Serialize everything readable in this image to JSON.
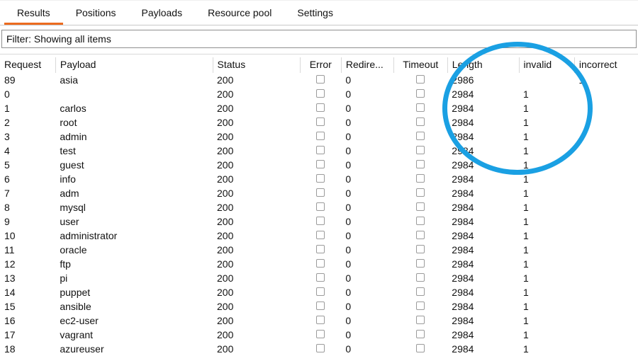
{
  "tabs": [
    "Results",
    "Positions",
    "Payloads",
    "Resource pool",
    "Settings"
  ],
  "active_tab": 0,
  "filter_text": "Filter: Showing all items",
  "columns": [
    "Request",
    "Payload",
    "Status",
    "Error",
    "Redire...",
    "Timeout",
    "Length",
    "invalid",
    "incorrect"
  ],
  "rows": [
    {
      "req": "89",
      "pay": "asia",
      "sta": "200",
      "red": "0",
      "len": "2986",
      "inv": "",
      "inc": "1"
    },
    {
      "req": "0",
      "pay": "",
      "sta": "200",
      "red": "0",
      "len": "2984",
      "inv": "1",
      "inc": ""
    },
    {
      "req": "1",
      "pay": "carlos",
      "sta": "200",
      "red": "0",
      "len": "2984",
      "inv": "1",
      "inc": ""
    },
    {
      "req": "2",
      "pay": "root",
      "sta": "200",
      "red": "0",
      "len": "2984",
      "inv": "1",
      "inc": ""
    },
    {
      "req": "3",
      "pay": "admin",
      "sta": "200",
      "red": "0",
      "len": "2984",
      "inv": "1",
      "inc": ""
    },
    {
      "req": "4",
      "pay": "test",
      "sta": "200",
      "red": "0",
      "len": "2984",
      "inv": "1",
      "inc": ""
    },
    {
      "req": "5",
      "pay": "guest",
      "sta": "200",
      "red": "0",
      "len": "2984",
      "inv": "1",
      "inc": ""
    },
    {
      "req": "6",
      "pay": "info",
      "sta": "200",
      "red": "0",
      "len": "2984",
      "inv": "1",
      "inc": ""
    },
    {
      "req": "7",
      "pay": "adm",
      "sta": "200",
      "red": "0",
      "len": "2984",
      "inv": "1",
      "inc": ""
    },
    {
      "req": "8",
      "pay": "mysql",
      "sta": "200",
      "red": "0",
      "len": "2984",
      "inv": "1",
      "inc": ""
    },
    {
      "req": "9",
      "pay": "user",
      "sta": "200",
      "red": "0",
      "len": "2984",
      "inv": "1",
      "inc": ""
    },
    {
      "req": "10",
      "pay": "administrator",
      "sta": "200",
      "red": "0",
      "len": "2984",
      "inv": "1",
      "inc": ""
    },
    {
      "req": "11",
      "pay": "oracle",
      "sta": "200",
      "red": "0",
      "len": "2984",
      "inv": "1",
      "inc": ""
    },
    {
      "req": "12",
      "pay": "ftp",
      "sta": "200",
      "red": "0",
      "len": "2984",
      "inv": "1",
      "inc": ""
    },
    {
      "req": "13",
      "pay": "pi",
      "sta": "200",
      "red": "0",
      "len": "2984",
      "inv": "1",
      "inc": ""
    },
    {
      "req": "14",
      "pay": "puppet",
      "sta": "200",
      "red": "0",
      "len": "2984",
      "inv": "1",
      "inc": ""
    },
    {
      "req": "15",
      "pay": "ansible",
      "sta": "200",
      "red": "0",
      "len": "2984",
      "inv": "1",
      "inc": ""
    },
    {
      "req": "16",
      "pay": "ec2-user",
      "sta": "200",
      "red": "0",
      "len": "2984",
      "inv": "1",
      "inc": ""
    },
    {
      "req": "17",
      "pay": "vagrant",
      "sta": "200",
      "red": "0",
      "len": "2984",
      "inv": "1",
      "inc": ""
    },
    {
      "req": "18",
      "pay": "azureuser",
      "sta": "200",
      "red": "0",
      "len": "2984",
      "inv": "1",
      "inc": ""
    }
  ],
  "annotation": "circle-highlight"
}
